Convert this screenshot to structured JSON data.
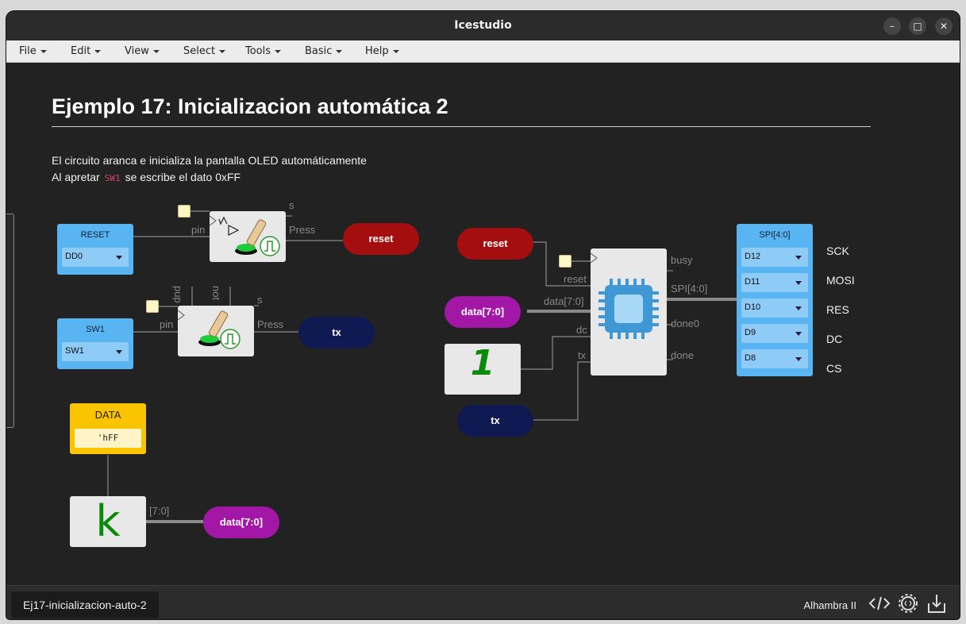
{
  "window": {
    "title": "Icestudio"
  },
  "menu": [
    "File",
    "Edit",
    "View",
    "Select",
    "Tools",
    "Basic",
    "Help"
  ],
  "doc": {
    "heading": "Ejemplo 17: Inicializacion automática 2",
    "line1": "El circuito aranca e inicializa la pantalla OLED automáticamente",
    "line2_pre": "Al apretar",
    "line2_code": "SW1",
    "line2_post": "se escribe el dato 0xFF"
  },
  "blocks": {
    "reset_in": {
      "label": "RESET",
      "pin": "DD0"
    },
    "sw1_in": {
      "label": "SW1",
      "pin": "SW1"
    },
    "button1": {
      "in_label": "pin",
      "out_s": "s",
      "out_press": "Press"
    },
    "button2": {
      "in_label": "pin",
      "top_pup": "pup",
      "top_not": "not",
      "out_s": "s",
      "out_press": "Press"
    },
    "tag_reset_out": "reset",
    "tag_tx_out": "tx",
    "constant": {
      "title": "DATA",
      "value": "'hFF"
    },
    "k_block": {
      "glyph": "k",
      "out_label": "[7:0]"
    },
    "tag_data_out": "data[7:0]",
    "tag_reset_in": "reset",
    "tag_data_in": "data[7:0]",
    "tag_tx_in": "tx",
    "one_block": {
      "glyph": "1"
    },
    "oled": {
      "in_reset": "reset",
      "in_data": "data[7:0]",
      "in_dc": "dc",
      "in_tx": "tx",
      "out_busy": "busy",
      "out_spi": "SPI[4:0]",
      "out_done0": "done0",
      "out_done": "done"
    },
    "spi_out": {
      "label": "SPI[4:0]",
      "pins": [
        "D12",
        "D11",
        "D10",
        "D9",
        "D8"
      ],
      "signals": [
        "SCK",
        "MOSI",
        "RES",
        "DC",
        "CS"
      ]
    }
  },
  "status": {
    "file_tab": "Ej17-inicializacion-auto-2",
    "board": "Alhambra II"
  },
  "colors": {
    "input_blue": "#59b4f2",
    "tag_red": "#a50e0e",
    "tag_navy": "#0f1a52",
    "tag_purple": "#a317a6",
    "constant_yellow": "#fbc400"
  }
}
